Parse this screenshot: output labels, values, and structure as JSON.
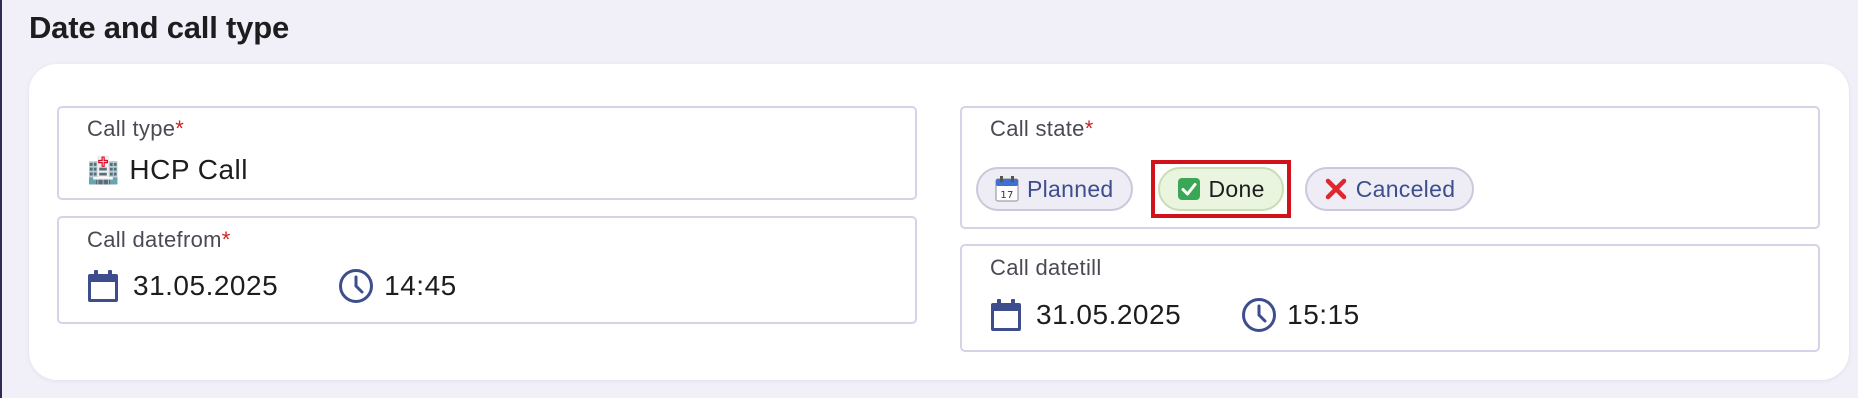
{
  "section": {
    "title": "Date and call type"
  },
  "call_type": {
    "label": "Call type",
    "required_mark": "*",
    "icon": "hospital-icon",
    "value": "HCP Call"
  },
  "call_datefrom": {
    "label": "Call datefrom",
    "required_mark": "*",
    "date": "31.05.2025",
    "time": "14:45"
  },
  "call_state": {
    "label": "Call state",
    "required_mark": "*",
    "options": [
      {
        "label": "Planned",
        "icon": "calendar-icon",
        "selected": false
      },
      {
        "label": "Done",
        "icon": "check-mark-icon",
        "selected": true
      },
      {
        "label": "Canceled",
        "icon": "cross-mark-icon",
        "selected": false
      }
    ]
  },
  "call_datetill": {
    "label": "Call datetill",
    "date": "31.05.2025",
    "time": "15:15"
  },
  "colors": {
    "accent": "#3e4e8c",
    "required": "#cc2222",
    "highlight": "#d0121b",
    "selected_chip": "#e9f5df"
  }
}
